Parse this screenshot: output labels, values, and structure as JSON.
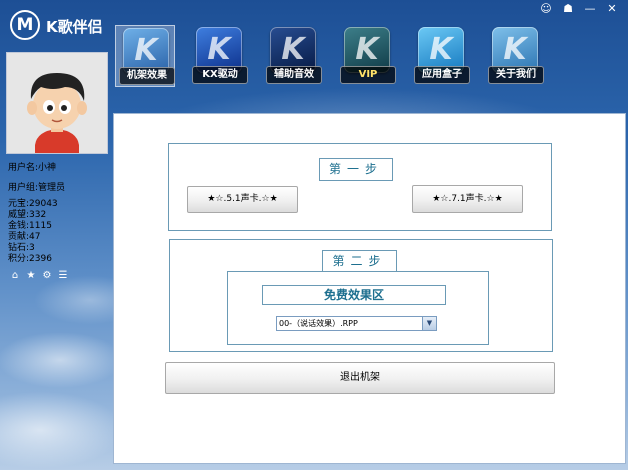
{
  "app": {
    "logo_letter": "M",
    "title": "K歌伴侣"
  },
  "window_controls": [
    "☺",
    "☗",
    "—",
    "✕"
  ],
  "toolbar": {
    "items": [
      {
        "label": "机架效果",
        "color": "#3a7dbf",
        "active": true
      },
      {
        "label": "KX驱动",
        "color": "#1b4fb0",
        "active": false
      },
      {
        "label": "辅助音效",
        "color": "#0e2f6e",
        "active": false
      },
      {
        "label": "VIP",
        "color": "#1f5f70",
        "active": false
      },
      {
        "label": "应用盒子",
        "color": "#2a9ad6",
        "active": false
      },
      {
        "label": "关于我们",
        "color": "#3f8fc5",
        "active": false
      }
    ]
  },
  "user": {
    "name_line": "用户名:小神",
    "group_line": "用户组:管理员",
    "stats": [
      "元宝:29043",
      "威望:332",
      "金钱:1115",
      "贡献:47",
      "钻石:3",
      "积分:2396"
    ],
    "mini_icons": [
      "home-icon",
      "star-icon",
      "gear-icon",
      "chat-icon"
    ]
  },
  "step1": {
    "title": "第一步",
    "btn_51": "★☆.5.1声卡.☆★",
    "btn_71": "★☆.7.1声卡.☆★"
  },
  "step2": {
    "title": "第二步",
    "free_zone": "免费效果区",
    "select_value": "00-（说话效果）.RPP"
  },
  "exit_button": "退出机架"
}
